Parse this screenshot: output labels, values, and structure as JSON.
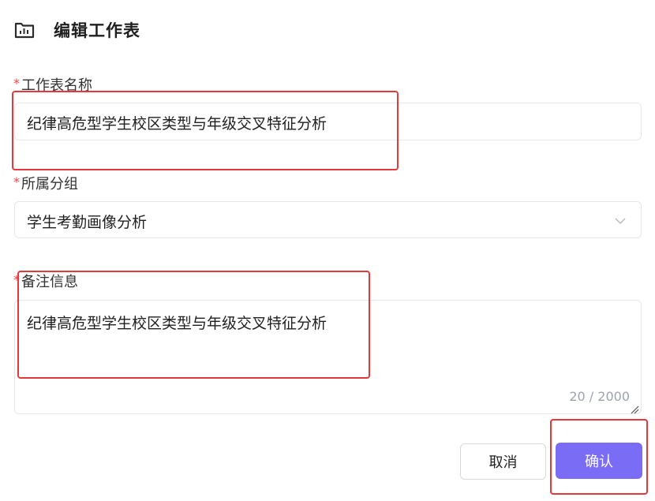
{
  "header": {
    "icon": "folder-chart-icon",
    "title": "编辑工作表"
  },
  "form": {
    "name_field": {
      "required_mark": "*",
      "label": "工作表名称",
      "value": "纪律高危型学生校区类型与年级交叉特征分析"
    },
    "group_field": {
      "required_mark": "*",
      "label": "所属分组",
      "selected": "学生考勤画像分析",
      "arrow_icon": "chevron-down-icon"
    },
    "notes_field": {
      "required_mark": "*",
      "label": "备注信息",
      "value": "纪律高危型学生校区类型与年级交叉特征分析",
      "counter": "20 / 2000"
    }
  },
  "actions": {
    "cancel_label": "取消",
    "confirm_label": "确认",
    "confirm_color": "#7b6cf6"
  },
  "annotation_color": "#e5383b"
}
